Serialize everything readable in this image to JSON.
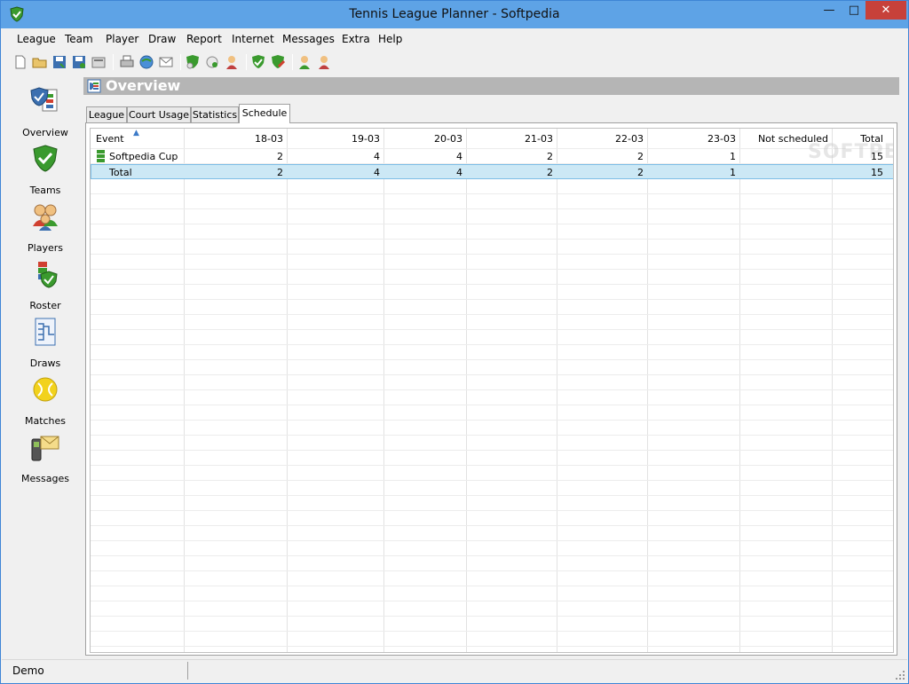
{
  "window": {
    "title": "Tennis League Planner - Softpedia"
  },
  "menu": [
    "League",
    "Team",
    "Player",
    "Draw",
    "Report",
    "Internet",
    "Messages",
    "Extra",
    "Help"
  ],
  "toolbar": {
    "icons": [
      "new-document-icon",
      "open-folder-icon",
      "save-icon",
      "save-as-icon",
      "properties-icon",
      "print-icon",
      "web-icon",
      "email-icon",
      "event-icon",
      "ball-icon",
      "players-icon",
      "check-icon",
      "edit-icon",
      "add-player-icon",
      "remove-player-icon"
    ]
  },
  "sidebar": {
    "items": [
      {
        "label": "Overview",
        "icon": "overview-icon"
      },
      {
        "label": "Teams",
        "icon": "teams-icon"
      },
      {
        "label": "Players",
        "icon": "players-icon"
      },
      {
        "label": "Roster",
        "icon": "roster-icon"
      },
      {
        "label": "Draws",
        "icon": "draws-icon"
      },
      {
        "label": "Matches",
        "icon": "matches-icon"
      },
      {
        "label": "Messages",
        "icon": "messages-icon"
      }
    ]
  },
  "overview": {
    "title": "Overview"
  },
  "tabs": [
    {
      "label": "League",
      "active": false
    },
    {
      "label": "Court Usage",
      "active": false
    },
    {
      "label": "Statistics",
      "active": false
    },
    {
      "label": "Schedule",
      "active": true
    }
  ],
  "schedule": {
    "columns": [
      "Event",
      "18-03",
      "19-03",
      "20-03",
      "21-03",
      "22-03",
      "23-03",
      "Not scheduled",
      "Total"
    ],
    "rows": [
      {
        "event": "Softpedia Cup",
        "values": [
          "2",
          "4",
          "4",
          "2",
          "2",
          "1",
          "",
          "15"
        ]
      },
      {
        "event": "Total",
        "values": [
          "2",
          "4",
          "4",
          "2",
          "2",
          "1",
          "",
          "15"
        ]
      }
    ],
    "watermark": "SOFTPEDIA"
  },
  "status": {
    "text": "Demo"
  },
  "colors": {
    "titlebar": "#5ea3e6",
    "close": "#c7413a",
    "header_band": "#b5b5b5",
    "selected_row": "#cce8f5"
  }
}
